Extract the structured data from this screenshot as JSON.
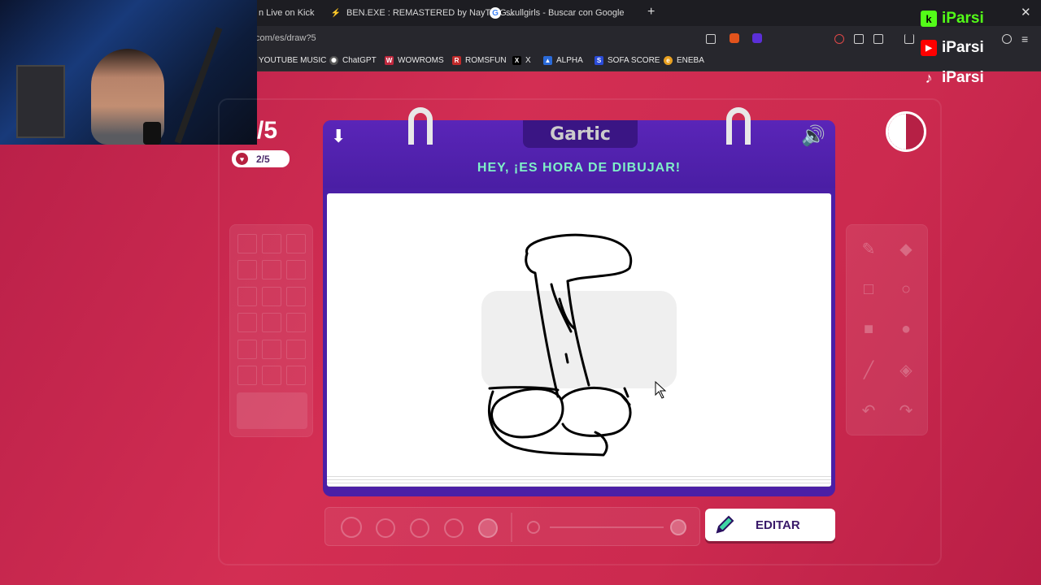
{
  "browser": {
    "tabs": [
      {
        "label": "n Live on Kick",
        "icon": "kick-icon"
      },
      {
        "label": "BEN.EXE : REMASTERED by NayTeeG...",
        "icon": "bolt-icon"
      },
      {
        "label": "skullgirls - Buscar con Google",
        "icon": "google-icon"
      }
    ],
    "new_tab": "+",
    "close": "✕",
    "url": "com/es/draw?5",
    "bookmarks": [
      {
        "label": "YOUTUBE MUSIC",
        "color": "#27272d"
      },
      {
        "label": "ChatGPT",
        "color": "#555555"
      },
      {
        "label": "WOWROMS",
        "color": "#c0283e"
      },
      {
        "label": "ROMSFUN",
        "color": "#c02a2a"
      },
      {
        "label": "X",
        "color": "#000000"
      },
      {
        "label": "ALPHA",
        "color": "#2a6ad8"
      },
      {
        "label": "SOFA SCORE",
        "color": "#2a4bd8"
      },
      {
        "label": "ENEBA",
        "color": "#e8a020"
      }
    ]
  },
  "overlays": {
    "kick": "iParsi",
    "youtube": "iParsi",
    "tiktok": "iParsi"
  },
  "game": {
    "round": "/5",
    "lives": "2/5",
    "logo": "Gartic",
    "title": "HEY, ¡ES HORA DE DIBUJAR!",
    "edit_button": "EDITAR",
    "colors": {
      "accent_green": "#7ff0c8",
      "book_purple": "#4b1fa6",
      "background": "#c8254d"
    }
  }
}
